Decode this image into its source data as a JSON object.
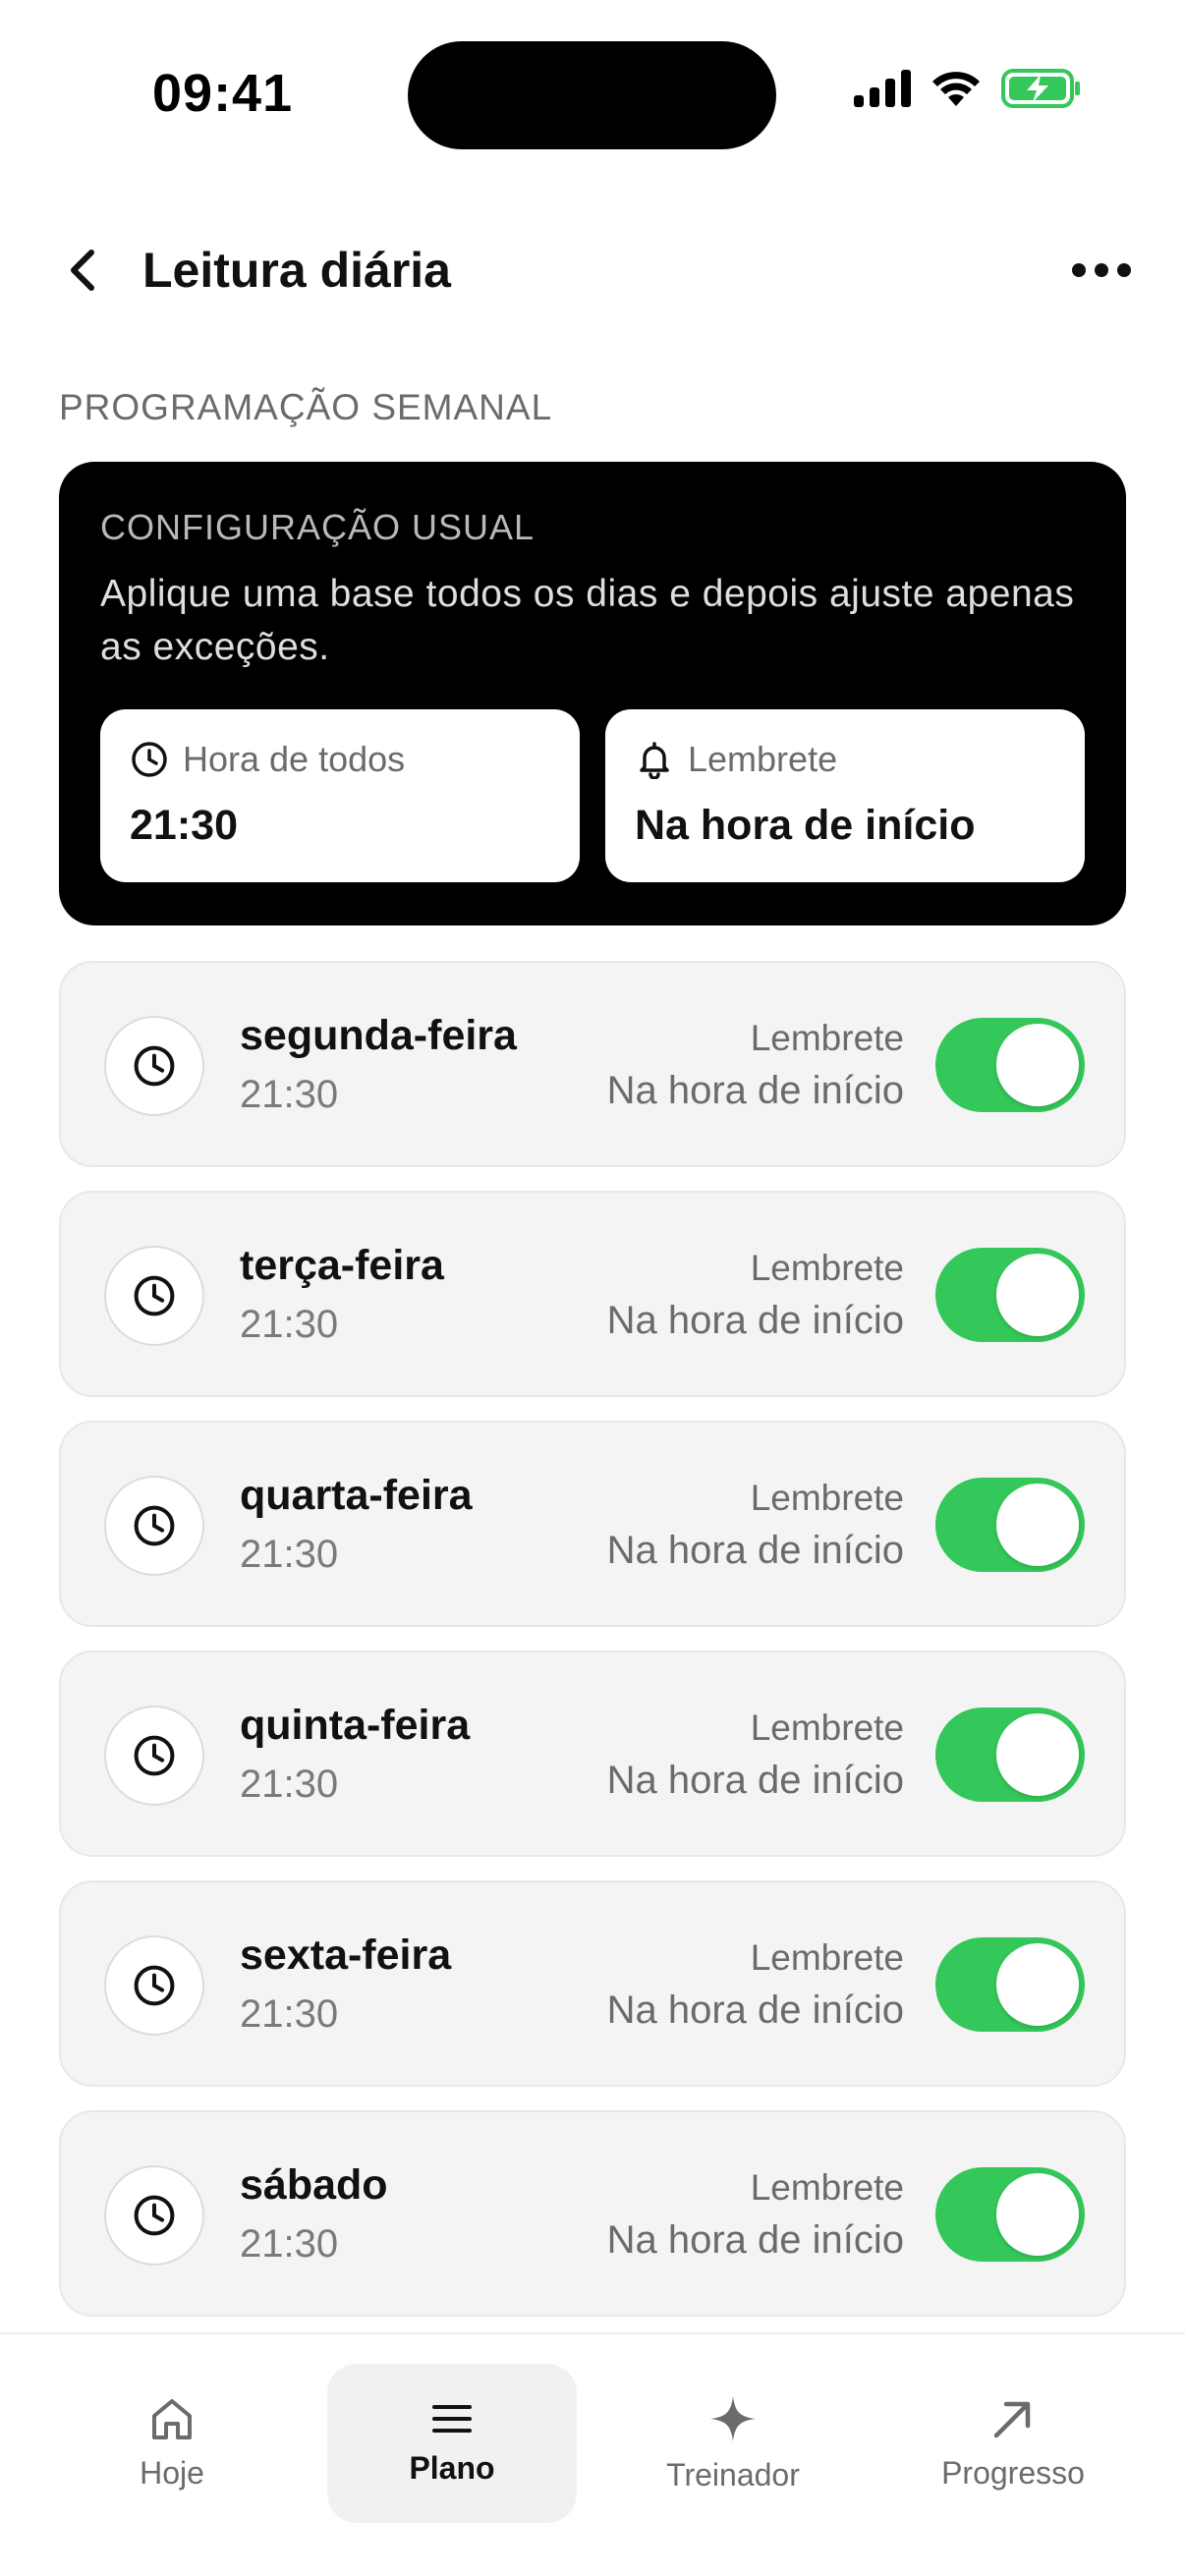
{
  "status_bar": {
    "time": "09:41"
  },
  "header": {
    "title": "Leitura diária"
  },
  "section": {
    "label": "PROGRAMAÇÃO SEMANAL"
  },
  "config": {
    "title": "CONFIGURAÇÃO USUAL",
    "description": "Aplique uma base todos os dias e depois ajuste apenas as exceções.",
    "time_label": "Hora de todos",
    "time_value": "21:30",
    "reminder_label": "Lembrete",
    "reminder_value": "Na hora de início"
  },
  "days": [
    {
      "name": "segunda-feira",
      "time": "21:30",
      "reminder_label": "Lembrete",
      "reminder_value": "Na hora de início",
      "enabled": true
    },
    {
      "name": "terça-feira",
      "time": "21:30",
      "reminder_label": "Lembrete",
      "reminder_value": "Na hora de início",
      "enabled": true
    },
    {
      "name": "quarta-feira",
      "time": "21:30",
      "reminder_label": "Lembrete",
      "reminder_value": "Na hora de início",
      "enabled": true
    },
    {
      "name": "quinta-feira",
      "time": "21:30",
      "reminder_label": "Lembrete",
      "reminder_value": "Na hora de início",
      "enabled": true
    },
    {
      "name": "sexta-feira",
      "time": "21:30",
      "reminder_label": "Lembrete",
      "reminder_value": "Na hora de início",
      "enabled": true
    },
    {
      "name": "sábado",
      "time": "21:30",
      "reminder_label": "Lembrete",
      "reminder_value": "Na hora de início",
      "enabled": true
    }
  ],
  "tabs": [
    {
      "label": "Hoje",
      "icon": "home-icon",
      "active": false
    },
    {
      "label": "Plano",
      "icon": "menu-icon",
      "active": true
    },
    {
      "label": "Treinador",
      "icon": "sparkle-icon",
      "active": false
    },
    {
      "label": "Progresso",
      "icon": "arrow-up-right-icon",
      "active": false
    }
  ],
  "colors": {
    "toggle_on": "#34c759",
    "battery": "#34c759",
    "card_dark": "#000000"
  }
}
